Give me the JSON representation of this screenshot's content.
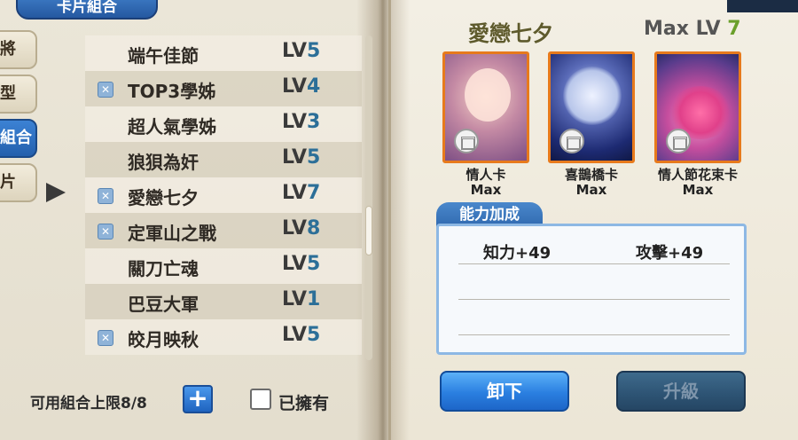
{
  "header": {
    "title": "卡片組合"
  },
  "side_tabs": [
    "將",
    "型",
    "組合",
    "片"
  ],
  "list": [
    {
      "name": "端午佳節",
      "lv_prefix": "LV",
      "lv": "5",
      "owned": false
    },
    {
      "name": "TOP3學姊",
      "lv_prefix": "LV",
      "lv": "4",
      "owned": true
    },
    {
      "name": "超人氣學姊",
      "lv_prefix": "LV",
      "lv": "3",
      "owned": false
    },
    {
      "name": "狼狽為奸",
      "lv_prefix": "LV",
      "lv": "5",
      "owned": false
    },
    {
      "name": "愛戀七夕",
      "lv_prefix": "LV",
      "lv": "7",
      "owned": true
    },
    {
      "name": "定軍山之戰",
      "lv_prefix": "LV",
      "lv": "8",
      "owned": true
    },
    {
      "name": "關刀亡魂",
      "lv_prefix": "LV",
      "lv": "5",
      "owned": false
    },
    {
      "name": "巴豆大軍",
      "lv_prefix": "LV",
      "lv": "1",
      "owned": false
    },
    {
      "name": "皎月映秋",
      "lv_prefix": "LV",
      "lv": "5",
      "owned": true
    }
  ],
  "footer": {
    "combo_limit": "可用組合上限8/8",
    "plus": "+",
    "owned_label": "已擁有"
  },
  "detail": {
    "title": "愛戀七夕",
    "max_lv_label": "Max LV",
    "max_lv_value": "7",
    "cards": [
      {
        "name": "情人卡",
        "level": "Max"
      },
      {
        "name": "喜鵲橋卡",
        "level": "Max"
      },
      {
        "name": "情人節花束卡",
        "level": "Max"
      }
    ],
    "ability_title": "能力加成",
    "stats": [
      "知力+49",
      "攻擊+49"
    ],
    "unload_label": "卸下",
    "upgrade_label": "升級"
  },
  "colors": {
    "accent_blue": "#2a7fe0",
    "lv_number": "#2c6f98",
    "card_border": "#e77a1c"
  }
}
